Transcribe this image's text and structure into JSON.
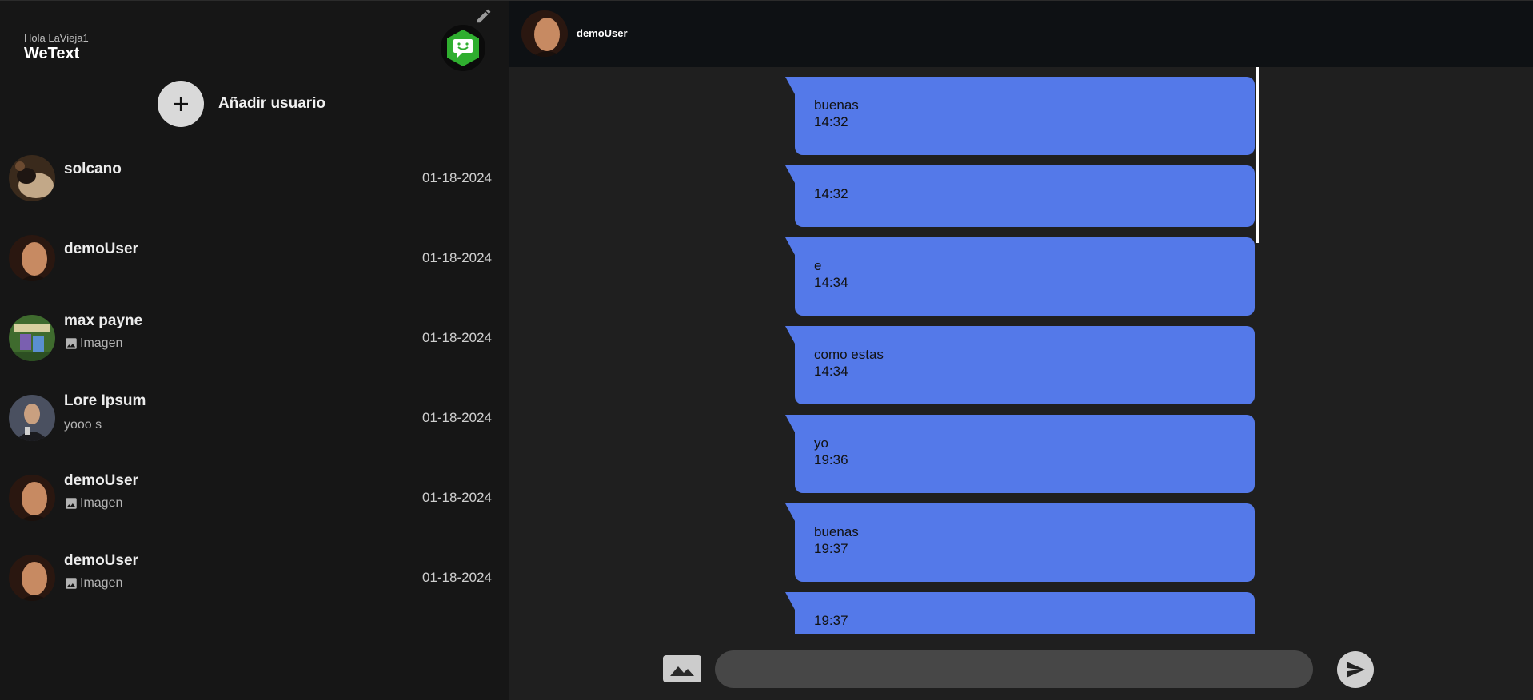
{
  "sidebar": {
    "greeting": "Hola LaVieja1",
    "app_title": "WeText",
    "add_user_label": "Añadir usuario",
    "contacts": [
      {
        "name": "solcano",
        "subtitle": "",
        "has_image": false,
        "date": "01-18-2024"
      },
      {
        "name": "demoUser",
        "subtitle": "",
        "has_image": false,
        "date": "01-18-2024"
      },
      {
        "name": "max payne",
        "subtitle": "Imagen",
        "has_image": true,
        "date": "01-18-2024"
      },
      {
        "name": "Lore Ipsum",
        "subtitle": "yooo s",
        "has_image": false,
        "date": "01-18-2024"
      },
      {
        "name": "demoUser",
        "subtitle": "Imagen",
        "has_image": true,
        "date": "01-18-2024"
      },
      {
        "name": "demoUser",
        "subtitle": "Imagen",
        "has_image": true,
        "date": "01-18-2024"
      }
    ]
  },
  "chat": {
    "contact_name": "demoUser",
    "messages": [
      {
        "text": "buenas",
        "time": "14:32"
      },
      {
        "text": "",
        "time": "14:32"
      },
      {
        "text": "e",
        "time": "14:34"
      },
      {
        "text": "como estas",
        "time": "14:34"
      },
      {
        "text": "yo",
        "time": "19:36"
      },
      {
        "text": "buenas",
        "time": "19:37"
      },
      {
        "text": "",
        "time": "19:37"
      }
    ]
  },
  "composer": {
    "placeholder": ""
  },
  "icons": {
    "edit": "pencil-icon",
    "logo": "chat-bubble-smile-icon",
    "add": "plus-icon",
    "image": "image-icon",
    "send": "send-icon"
  },
  "colors": {
    "sidebar_bg": "#161616",
    "chat_bg": "#1f1f1f",
    "header_bg": "#0e1114",
    "bubble": "#5479e9",
    "logo_green": "#2fae2f"
  }
}
